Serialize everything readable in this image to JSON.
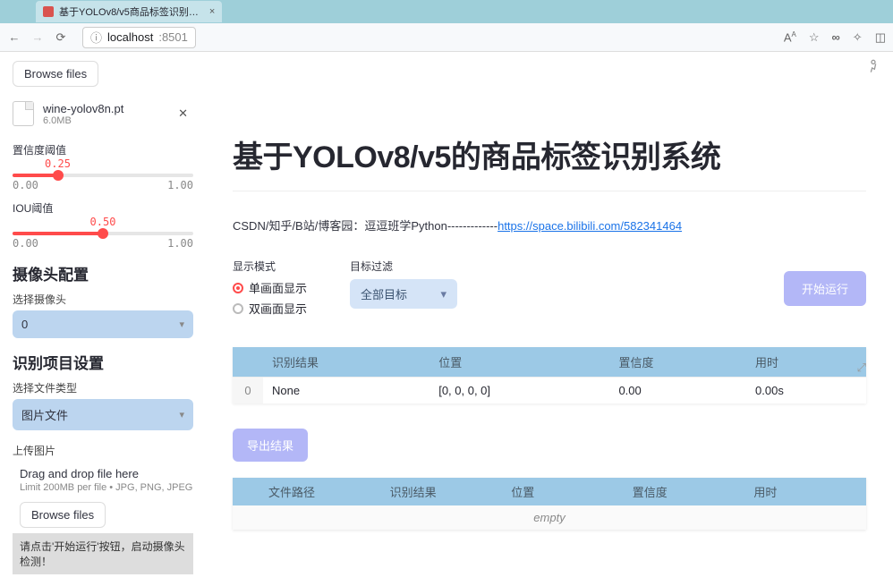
{
  "browser": {
    "tab_title": "基于YOLOv8/v5商品标签识别…",
    "url_host": "localhost",
    "url_port": ":8501",
    "nav_icons": {
      "aA": "A",
      "star": "☆",
      "infinity": "∞"
    }
  },
  "sidebar": {
    "browse_label": "Browse files",
    "uploaded_file": {
      "name": "wine-yolov8n.pt",
      "size": "6.0MB"
    },
    "conf_slider": {
      "label": "置信度阈值",
      "value": "0.25",
      "min": "0.00",
      "max": "1.00",
      "pct": 25
    },
    "iou_slider": {
      "label": "IOU阈值",
      "value": "0.50",
      "min": "0.00",
      "max": "1.00",
      "pct": 50
    },
    "camera_section": "摄像头配置",
    "camera_select_label": "选择摄像头",
    "camera_value": "0",
    "project_section": "识别项目设置",
    "filetype_label": "选择文件类型",
    "filetype_value": "图片文件",
    "upload_label": "上传图片",
    "upload_hint": "Drag and drop file here",
    "upload_sub": "Limit 200MB per file • JPG, PNG, JPEG",
    "browse_label_2": "Browse files",
    "info_text": "请点击'开始运行'按钮，启动摄像头检测！"
  },
  "main": {
    "title": "基于YOLOv8/v5的商品标签识别系统",
    "byline_prefix": "CSDN/知乎/B站/博客园：逗逗班学Python-------------",
    "byline_link": "https://space.bilibili.com/582341464",
    "display_mode_label": "显示模式",
    "radio_single": "单画面显示",
    "radio_double": "双画面显示",
    "target_filter_label": "目标过滤",
    "target_filter_value": "全部目标",
    "run_button": "开始运行",
    "export_button": "导出结果",
    "table1": {
      "headers": [
        "",
        "识别结果",
        "位置",
        "置信度",
        "用时"
      ],
      "rows": [
        {
          "idx": "0",
          "result": "None",
          "pos": "[0, 0, 0, 0]",
          "conf": "0.00",
          "time": "0.00s"
        }
      ]
    },
    "table2": {
      "headers": [
        "",
        "文件路径",
        "识别结果",
        "位置",
        "置信度",
        "用时"
      ],
      "empty": "empty"
    }
  }
}
